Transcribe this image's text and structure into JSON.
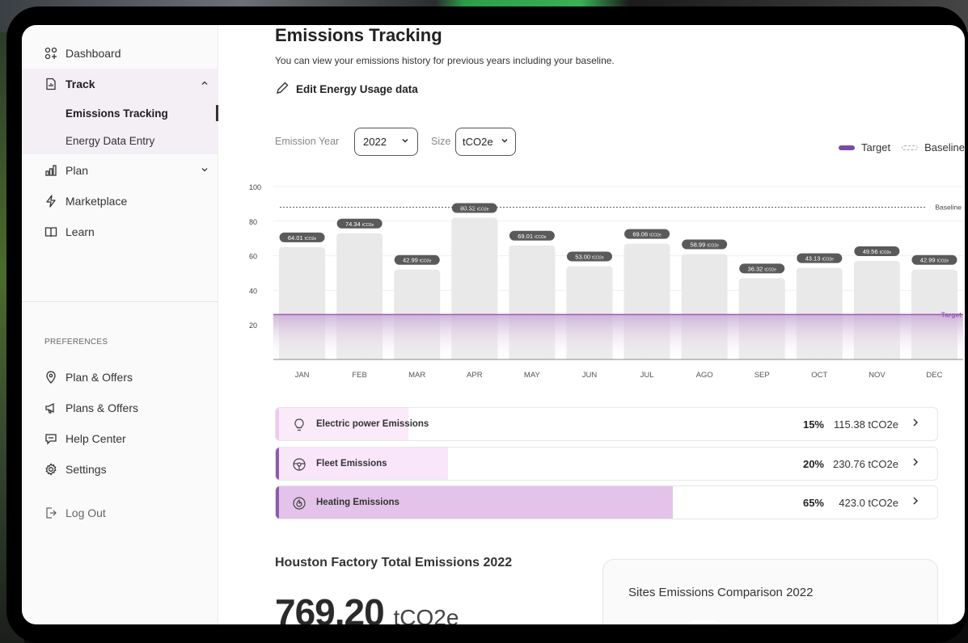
{
  "sidebar": {
    "nav": [
      {
        "label": "Dashboard",
        "icon": "dashboard-icon"
      },
      {
        "label": "Track",
        "icon": "track-icon",
        "expanded": true
      },
      {
        "label": "Plan",
        "icon": "plan-icon",
        "expanded": false
      },
      {
        "label": "Marketplace",
        "icon": "lightning-icon"
      },
      {
        "label": "Learn",
        "icon": "book-icon"
      }
    ],
    "track_sub": [
      "Emissions Tracking",
      "Energy Data Entry"
    ],
    "preferences_title": "PREFERENCES",
    "preferences": [
      {
        "label": "Plan & Offers",
        "icon": "location-pin-icon"
      },
      {
        "label": "Plans & Offers",
        "icon": "megaphone-icon"
      },
      {
        "label": "Help Center",
        "icon": "chat-icon"
      },
      {
        "label": "Settings",
        "icon": "gear-icon"
      }
    ],
    "logout": "Log Out"
  },
  "header": {
    "title": "Emissions Tracking",
    "description": "You can view your emissions history for previous years including your baseline.",
    "edit_link": "Edit Energy Usage data"
  },
  "filters": {
    "year_label": "Emission Year",
    "year_value": "2022",
    "size_label": "Size",
    "size_value": "tCO2e"
  },
  "legend": {
    "target": "Target",
    "baseline": "Baseline"
  },
  "chart_data": {
    "type": "bar",
    "categories": [
      "JAN",
      "FEB",
      "MAR",
      "APR",
      "MAY",
      "JUN",
      "JUL",
      "AGO",
      "SEP",
      "OCT",
      "NOV",
      "DEC"
    ],
    "values": [
      64.01,
      74.34,
      42.99,
      80.32,
      69.01,
      53.0,
      69.06,
      58.99,
      36.32,
      43.13,
      49.56,
      42.99
    ],
    "bar_heights": [
      65,
      73,
      52,
      82,
      66,
      54,
      67,
      61,
      47,
      53,
      57,
      52
    ],
    "label_unit": "tCO2e",
    "yticks": [
      100,
      80,
      60,
      40,
      20
    ],
    "ylim": [
      0,
      100
    ],
    "baseline": 88,
    "baseline_label": "Baseline",
    "target": 26,
    "target_label": "Target",
    "colors": {
      "bar": "#e9e9e9",
      "label_bg": "#5a5a5a",
      "target": "#9a5cb8",
      "baseline": "#555555"
    }
  },
  "categories": [
    {
      "name": "Electric power Emissions",
      "percent": "15%",
      "value": "115.38 tCO2e",
      "fill": 0.2,
      "fill_color": "#faeafa",
      "edge_color": "#f1c8ef",
      "icon": "lightbulb-icon"
    },
    {
      "name": "Fleet Emissions",
      "percent": "20%",
      "value": "230.76 tCO2e",
      "fill": 0.26,
      "fill_color": "#f9e6fb",
      "edge_color": "#8e5ba8",
      "icon": "steering-wheel-icon"
    },
    {
      "name": "Heating Emissions",
      "percent": "65%",
      "value": "423.0 tCO2e",
      "fill": 0.6,
      "fill_color": "#e3c3e9",
      "edge_color": "#8e5ba8",
      "icon": "flame-icon"
    }
  ],
  "total": {
    "title": "Houston Factory Total Emissions 2022",
    "value": "769.20",
    "unit": "tCO2e"
  },
  "sites": {
    "title": "Sites Emissions Comparison 2022"
  }
}
